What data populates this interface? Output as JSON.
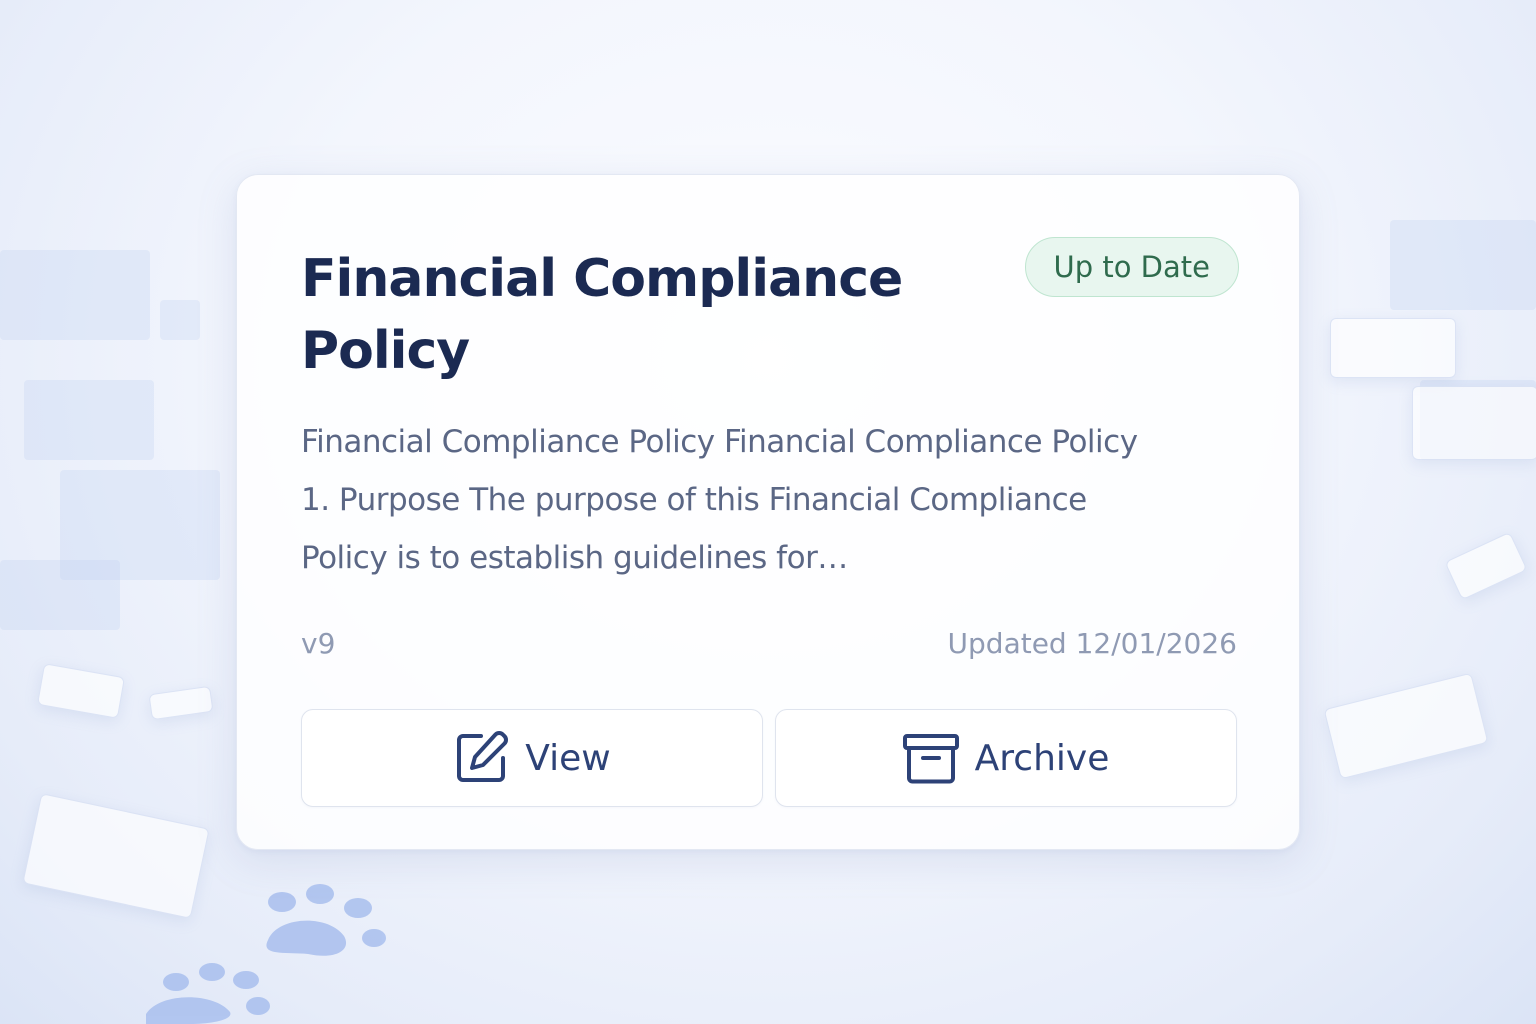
{
  "card": {
    "title": "Financial Compliance Policy",
    "status": "Up to Date",
    "excerpt": "Financial Compliance Policy Financial Compliance Policy 1. Purpose The purpose of this Financial Compliance Policy is to establish guidelines for…",
    "version": "v9",
    "updated": "Updated 12/01/2026",
    "actions": {
      "view_label": "View",
      "view_icon": "edit-icon",
      "archive_label": "Archive",
      "archive_icon": "archive-box-icon"
    }
  },
  "colors": {
    "title": "#1b2a52",
    "excerpt": "#5b6785",
    "meta": "#8f9ab3",
    "badge_bg": "#e8f6ef",
    "badge_border": "#bfe5d0",
    "badge_text": "#2f6b4d",
    "action_text": "#2d4277",
    "background": "#eef2fb"
  }
}
